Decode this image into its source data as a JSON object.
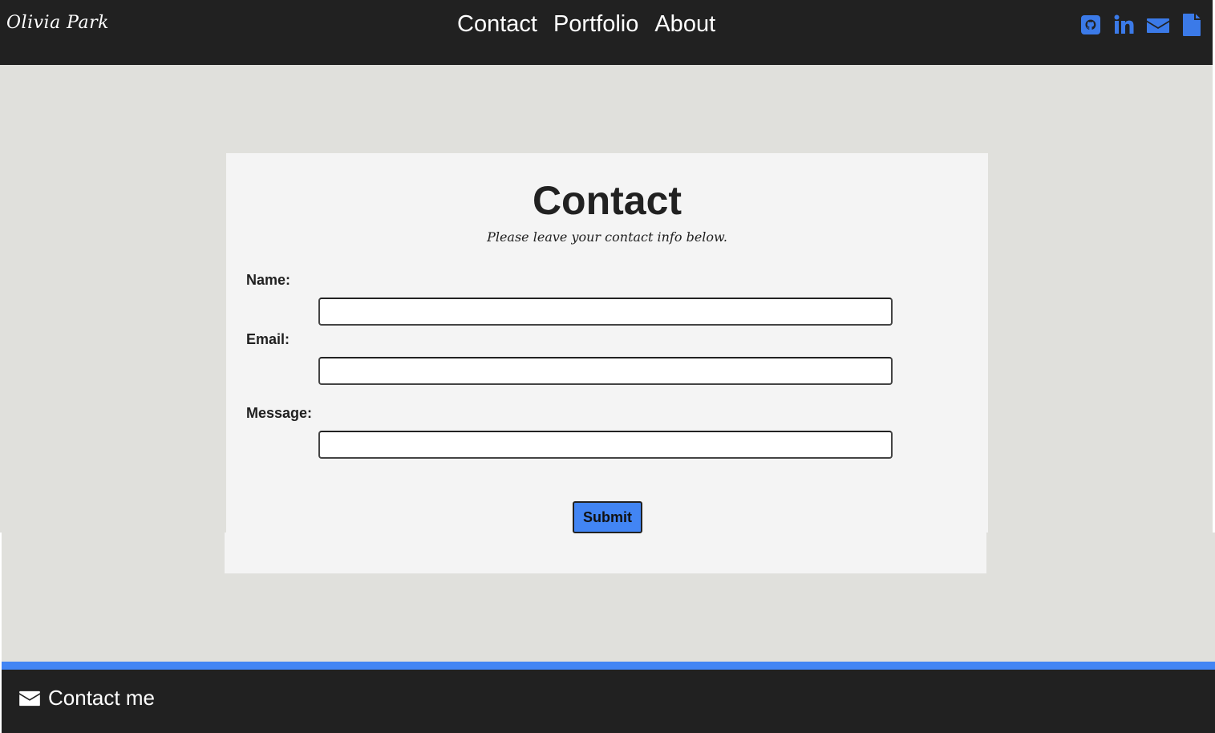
{
  "header": {
    "brand": "Olivia Park",
    "nav": [
      {
        "label": "Contact"
      },
      {
        "label": "Portfolio"
      },
      {
        "label": "About"
      }
    ],
    "social_icons": [
      "github-icon",
      "linkedin-icon",
      "envelope-icon",
      "document-icon"
    ]
  },
  "main": {
    "title": "Contact",
    "subtitle": "Please leave your contact info below.",
    "form": {
      "name_label": "Name:",
      "name_value": "",
      "email_label": "Email:",
      "email_value": "",
      "message_label": "Message:",
      "message_value": "",
      "submit_label": "Submit"
    }
  },
  "footer": {
    "contact_label": "Contact me",
    "icon": "envelope-icon"
  },
  "colors": {
    "nav_background": "#212121",
    "page_background": "#e0e0dc",
    "card_background": "#f4f4f4",
    "accent": "#4285f4",
    "text_dark": "#212121"
  }
}
